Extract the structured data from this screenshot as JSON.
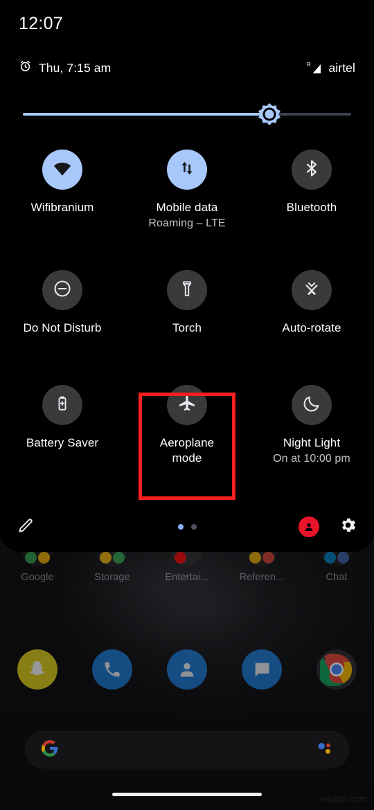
{
  "status_bar": {
    "clock": "12:07",
    "alarm_icon": "alarm-clock-icon",
    "alarm_text": "Thu, 7:15 am",
    "signal_icon": "signal-roaming-icon",
    "roaming_superscript": "R",
    "carrier": "airtel"
  },
  "brightness": {
    "icon": "brightness-sun-icon",
    "value_percent": 75,
    "fill_color": "#a8c7fa",
    "track_color": "#3b4152"
  },
  "tiles": [
    [
      {
        "name": "wifi",
        "icon": "wifi-icon",
        "label": "Wifibranium",
        "sub": "",
        "active": true
      },
      {
        "name": "mobile-data",
        "icon": "mobile-data-arrows-icon",
        "label": "Mobile data",
        "sub": "Roaming – LTE",
        "active": true
      },
      {
        "name": "bluetooth",
        "icon": "bluetooth-icon",
        "label": "Bluetooth",
        "sub": "",
        "active": false
      }
    ],
    [
      {
        "name": "do-not-disturb",
        "icon": "do-not-disturb-icon",
        "label": "Do Not Disturb",
        "sub": "",
        "active": false
      },
      {
        "name": "torch",
        "icon": "flashlight-icon",
        "label": "Torch",
        "sub": "",
        "active": false
      },
      {
        "name": "auto-rotate",
        "icon": "auto-rotate-icon",
        "label": "Auto-rotate",
        "sub": "",
        "active": false
      }
    ],
    [
      {
        "name": "battery-saver",
        "icon": "battery-saver-icon",
        "label": "Battery Saver",
        "sub": "",
        "active": false
      },
      {
        "name": "aeroplane-mode",
        "icon": "airplane-icon",
        "label": "Aeroplane mode",
        "sub": "",
        "active": false,
        "highlighted": true
      },
      {
        "name": "night-light",
        "icon": "moon-icon",
        "label": "Night Light",
        "sub": "On at 10:00 pm",
        "active": false
      }
    ]
  ],
  "highlight": {
    "color": "#fa2020",
    "target": "Aeroplane mode"
  },
  "footer": {
    "edit_icon": "pencil-edit-icon",
    "pages": 2,
    "active_page": 1,
    "user_icon": "user-avatar-icon",
    "user_color": "#e8142a",
    "settings_icon": "gear-settings-icon"
  },
  "home_screen": {
    "folders": [
      {
        "label": "Google"
      },
      {
        "label": "Storage"
      },
      {
        "label": "Entertai..."
      },
      {
        "label": "Referen..."
      },
      {
        "label": "Chat"
      }
    ],
    "dock": [
      {
        "name": "snapchat-icon"
      },
      {
        "name": "phone-icon"
      },
      {
        "name": "contacts-icon"
      },
      {
        "name": "messages-icon"
      },
      {
        "name": "chrome-icon"
      }
    ],
    "search": {
      "logo": "google-g-icon",
      "assistant_icon": "google-assistant-icon",
      "placeholder": ""
    },
    "nav_gesture_bar": true
  },
  "watermark": "wsxdn.com"
}
